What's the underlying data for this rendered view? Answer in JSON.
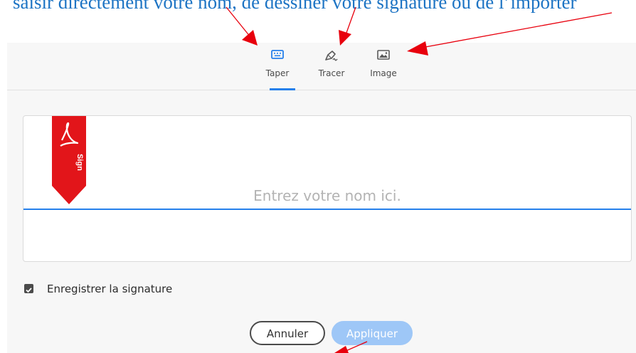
{
  "caption": "saisir directement votre nom, de dessiner votre signature ou de l’importer",
  "tabs": [
    {
      "label": "Taper",
      "icon": "keyboard-icon",
      "active": true
    },
    {
      "label": "Tracer",
      "icon": "pen-draw-icon",
      "active": false
    },
    {
      "label": "Image",
      "icon": "image-icon",
      "active": false
    }
  ],
  "ribbon": {
    "label": "Sign",
    "color": "#e2151a"
  },
  "name_input": {
    "placeholder": "Entrez votre nom ici."
  },
  "save_signature": {
    "label": "Enregistrer la signature",
    "checked": true
  },
  "buttons": {
    "cancel": "Annuler",
    "apply": "Appliquer"
  },
  "colors": {
    "accent": "#2680eb",
    "annotation": "#1d74c4",
    "arrow": "#e8000d"
  }
}
